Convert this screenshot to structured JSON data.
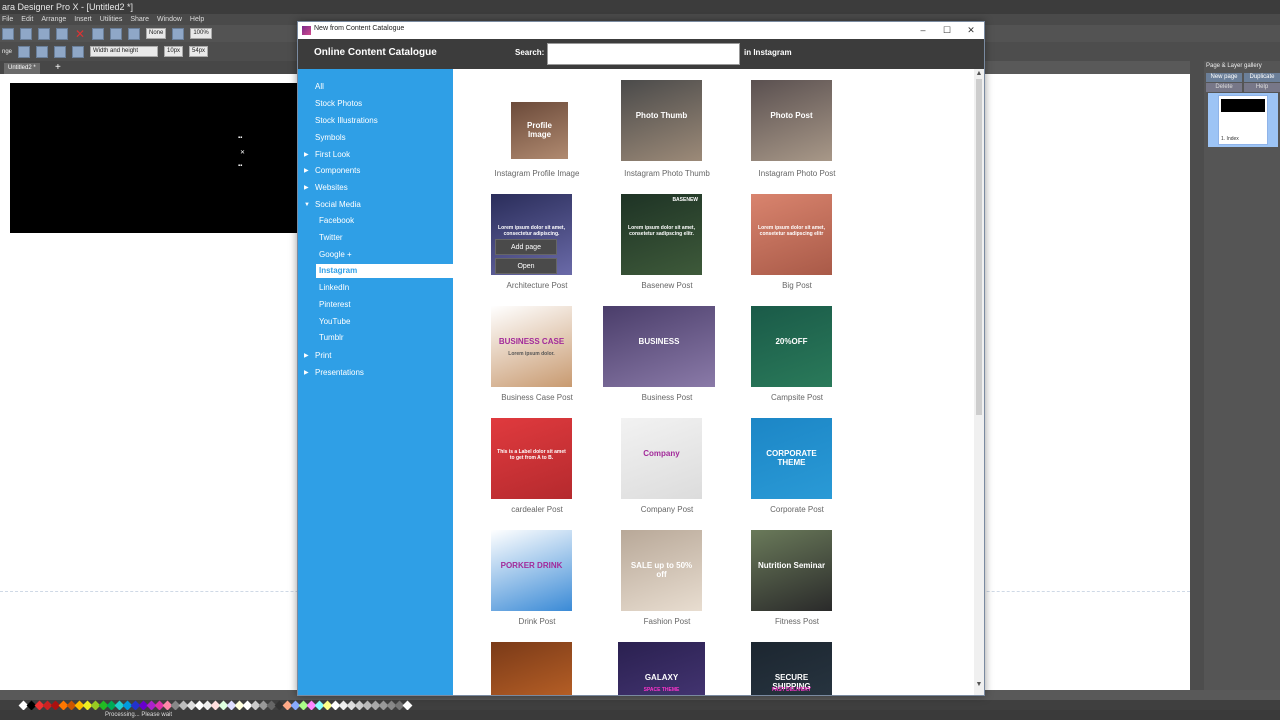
{
  "app": {
    "title": "ara Designer Pro X - [Untitled2 *]",
    "menu": [
      "File",
      "Edit",
      "Arrange",
      "Insert",
      "Utilities",
      "Share",
      "Window",
      "Help"
    ],
    "toolbar": {
      "none_select": "None",
      "zoom_select": "100%",
      "size_mode": "Width and height",
      "w_value": "10px",
      "h_value": "54px",
      "label_left": "nge"
    },
    "doc_tab": "Untitled2 *",
    "right_panel": {
      "title": "Page & Layer gallery",
      "new_page": "New page",
      "duplicate": "Duplicate",
      "delete": "Delete",
      "help": "Help",
      "thumb_label": "1. Index"
    },
    "status": "Processing... Please wait"
  },
  "dialog": {
    "title": "New from Content Catalogue",
    "heading": "Online Content Catalogue",
    "search_label": "Search:",
    "search_value": "",
    "search_suffix": "in Instagram",
    "nav": [
      {
        "label": "All",
        "expandable": false,
        "child": false
      },
      {
        "label": "Stock Photos",
        "expandable": false,
        "child": false
      },
      {
        "label": "Stock Illustrations",
        "expandable": false,
        "child": false
      },
      {
        "label": "Symbols",
        "expandable": false,
        "child": false
      },
      {
        "label": "First Look",
        "expandable": true,
        "child": false
      },
      {
        "label": "Components",
        "expandable": true,
        "child": false
      },
      {
        "label": "Websites",
        "expandable": true,
        "child": false
      },
      {
        "label": "Social Media",
        "expandable": true,
        "expanded": true,
        "child": false
      },
      {
        "label": "Facebook",
        "child": true
      },
      {
        "label": "Twitter",
        "child": true
      },
      {
        "label": "Google +",
        "child": true
      },
      {
        "label": "Instagram",
        "child": true,
        "active": true
      },
      {
        "label": "LinkedIn",
        "child": true
      },
      {
        "label": "Pinterest",
        "child": true
      },
      {
        "label": "YouTube",
        "child": true
      },
      {
        "label": "Tumblr",
        "child": true
      },
      {
        "label": "Print",
        "expandable": true,
        "child": false
      },
      {
        "label": "Presentations",
        "expandable": true,
        "child": false
      }
    ],
    "items": [
      {
        "label": "Instagram Profile Image",
        "overlay": "Profile Image",
        "colors": [
          "#6b4a3a",
          "#b08a70"
        ]
      },
      {
        "label": "Instagram Photo Thumb",
        "overlay": "Photo Thumb",
        "colors": [
          "#4a4a4a",
          "#9c8a78"
        ]
      },
      {
        "label": "Instagram Photo Post",
        "overlay": "Photo Post",
        "colors": [
          "#5a5050",
          "#a89888"
        ]
      },
      {
        "label": "Architecture Post",
        "overlay": "Lorem ipsum dolor sit amet, consectetur adipiscing.",
        "colors": [
          "#2a2d5a",
          "#6a6aa8"
        ]
      },
      {
        "label": "Basenew Post",
        "overlay": "Lorem ipsum dolor sit amet, consetetur sadipscing elitr.",
        "tag": "BASENEW",
        "colors": [
          "#1e3325",
          "#3e5a3a"
        ]
      },
      {
        "label": "Big Post",
        "overlay": "Lorem ipsum dolor sit amet, consetetur sadipscing elitr",
        "colors": [
          "#d9846e",
          "#a95a48"
        ]
      },
      {
        "label": "Business Case Post",
        "overlay": "BUSINESS CASE",
        "sub": "Lorem ipsum dolor.",
        "colors": [
          "#ffffff",
          "#c89a70"
        ]
      },
      {
        "label": "Business Post",
        "overlay": "BUSINESS",
        "colors": [
          "#4a3d6a",
          "#8a7aa8"
        ]
      },
      {
        "label": "Campsite Post",
        "overlay": "20%OFF",
        "colors": [
          "#1a5a48",
          "#2a7a5a"
        ]
      },
      {
        "label": "cardealer Post",
        "overlay": "This is a Label dolor sit amet to get from A to B.",
        "colors": [
          "#e03a3e",
          "#b52a2e"
        ]
      },
      {
        "label": "Company Post",
        "overlay": "Company",
        "colors": [
          "#f2f2f2",
          "#dcdcdc"
        ]
      },
      {
        "label": "Corporate Post",
        "overlay": "CORPORATE THEME",
        "colors": [
          "#1c86c6",
          "#2a9ad6"
        ]
      },
      {
        "label": "Drink Post",
        "overlay": "PORKER DRINK",
        "colors": [
          "#ffffff",
          "#3a8ad6"
        ]
      },
      {
        "label": "Fashion Post",
        "overlay": "SALE up to 50% off",
        "colors": [
          "#b8a898",
          "#e8ddd0"
        ]
      },
      {
        "label": "Fitness Post",
        "overlay": "Nutrition Seminar",
        "colors": [
          "#6a7a5a",
          "#2a2a2a"
        ]
      },
      {
        "label": "",
        "overlay": "",
        "colors": [
          "#7a3a18",
          "#c86a2a"
        ]
      },
      {
        "label": "",
        "overlay": "GALAXY",
        "sub": "SPACE THEME",
        "colors": [
          "#2a2050",
          "#4a3a7a"
        ]
      },
      {
        "label": "",
        "overlay": "SECURE SHIPPING",
        "sub": "FAST DELIVERY",
        "colors": [
          "#1c2630",
          "#2a3844"
        ]
      }
    ],
    "context_menu": {
      "add_page": "Add page",
      "open": "Open"
    }
  }
}
